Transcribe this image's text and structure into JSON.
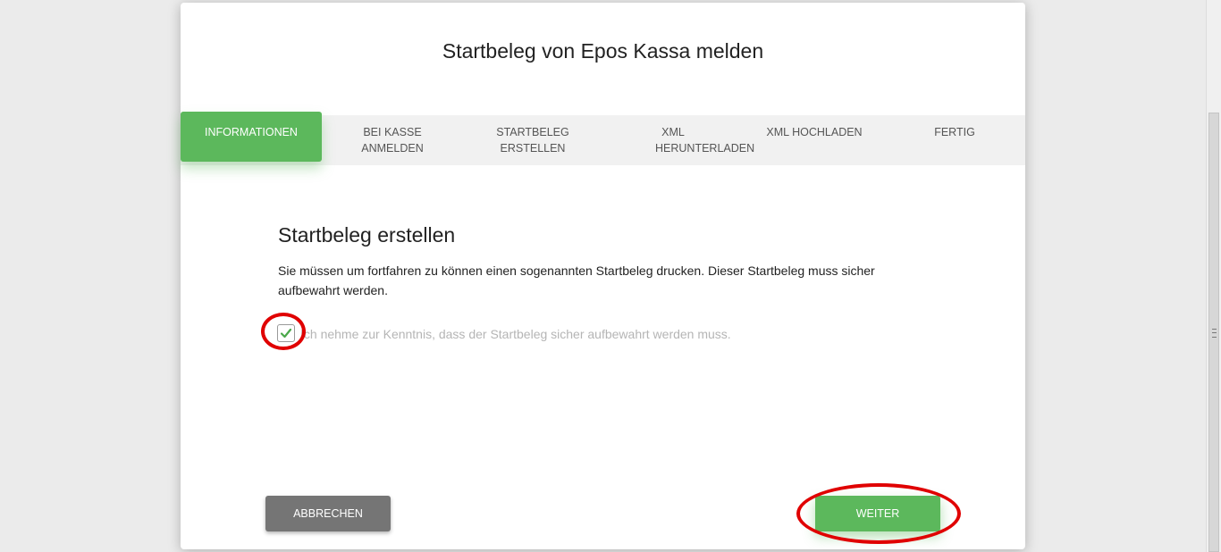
{
  "dialog": {
    "title": "Startbeleg von Epos Kassa melden"
  },
  "steps": [
    {
      "label": "INFORMATIONEN",
      "active": true
    },
    {
      "label": "BEI KASSE ANMELDEN",
      "active": false
    },
    {
      "label": "STARTBELEG ERSTELLEN",
      "active": false
    },
    {
      "label": "XML HERUNTERLADEN",
      "active": false
    },
    {
      "label": "XML HOCHLADEN",
      "active": false
    },
    {
      "label": "FERTIG",
      "active": false
    }
  ],
  "content": {
    "heading": "Startbeleg erstellen",
    "description": "Sie müssen um fortfahren zu können einen sogenannten Startbeleg drucken. Dieser Startbeleg muss sicher aufbewahrt werden.",
    "checkbox": {
      "checked": true,
      "label": "Ich nehme zur Kenntnis, dass der Startbeleg sicher aufbewahrt werden muss."
    }
  },
  "buttons": {
    "cancel": "ABBRECHEN",
    "next": "WEITER"
  },
  "colors": {
    "accent": "#5cb85c",
    "cancel": "#757575",
    "highlight_ring": "#e00000",
    "background": "#ebebeb"
  },
  "icons": {
    "checkbox": "check-icon"
  }
}
